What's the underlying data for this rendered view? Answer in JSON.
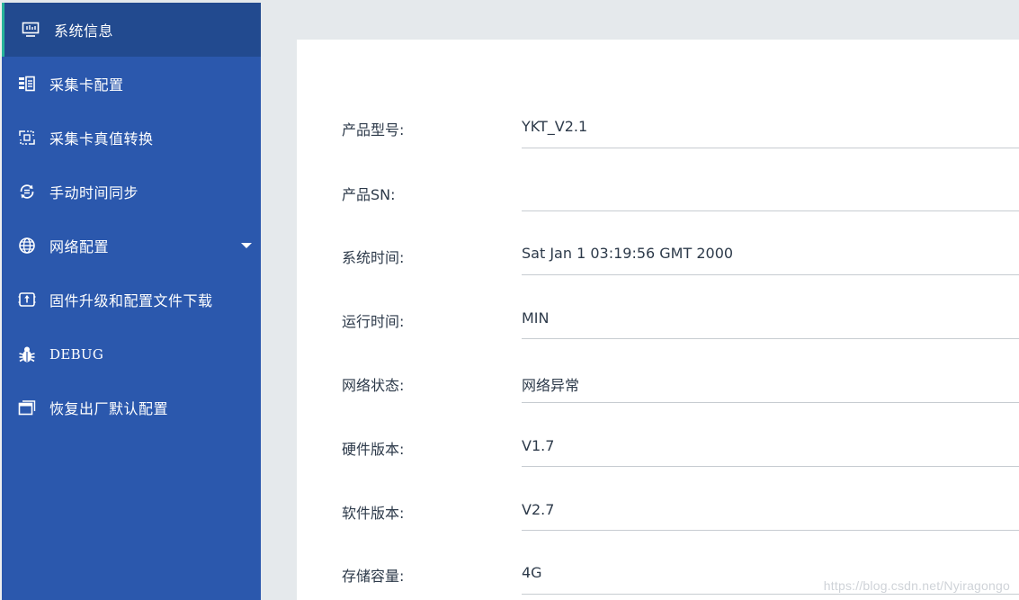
{
  "sidebar": {
    "items": [
      {
        "label": "系统信息",
        "icon": "monitor-icon",
        "active": true
      },
      {
        "label": "采集卡配置",
        "icon": "card-config-icon"
      },
      {
        "label": "采集卡真值转换",
        "icon": "convert-icon"
      },
      {
        "label": "手动时间同步",
        "icon": "sync-time-icon"
      },
      {
        "label": "网络配置",
        "icon": "globe-icon",
        "has_submenu": true
      },
      {
        "label": "固件升级和配置文件下载",
        "icon": "upgrade-icon"
      },
      {
        "label": "DEBUG",
        "icon": "bug-icon"
      },
      {
        "label": "恢复出厂默认配置",
        "icon": "window-icon"
      }
    ]
  },
  "info": {
    "rows": [
      {
        "label": "产品型号:",
        "value": "YKT_V2.1"
      },
      {
        "label": "产品SN:",
        "value": ""
      },
      {
        "label": "系统时间:",
        "value": "Sat Jan 1 03:19:56 GMT 2000"
      },
      {
        "label": "运行时间:",
        "value": "MIN"
      },
      {
        "label": "网络状态:",
        "value": "网络异常"
      },
      {
        "label": "硬件版本:",
        "value": "V1.7"
      },
      {
        "label": "软件版本:",
        "value": "V2.7"
      },
      {
        "label": "存储容量:",
        "value": "4G"
      }
    ]
  },
  "watermark": "https://blog.csdn.net/Nyiragongo",
  "colors": {
    "sidebar_bg": "#2b58ad",
    "sidebar_active_bg": "#224a8f",
    "active_indicator": "#28b59a",
    "page_bg": "#e5e9ec"
  }
}
